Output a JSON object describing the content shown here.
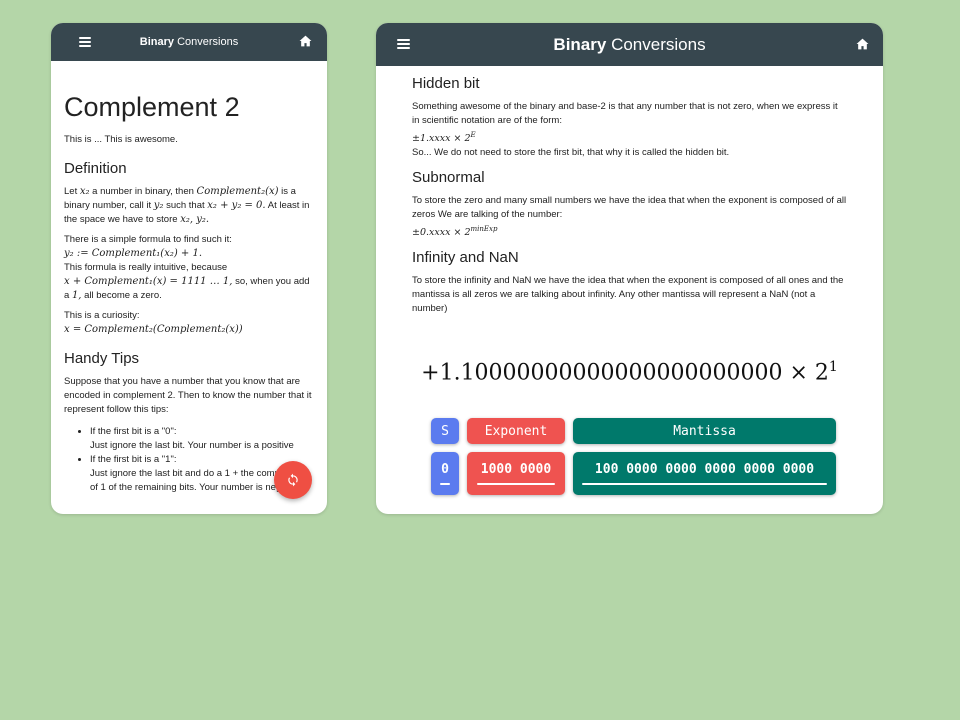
{
  "colors": {
    "background": "#b4d6a8",
    "appbar": "#37474f",
    "sign": "#5b7bef",
    "exponent": "#ef5350",
    "mantissa": "#00796b",
    "fab": "#ef4f43"
  },
  "app": {
    "title_bold": "Binary",
    "title_rest": "Conversions",
    "menu_icon": "hamburger-icon",
    "home_icon": "home-icon"
  },
  "phone": {
    "heading_light": "Complement",
    "heading_bold": "2",
    "intro": "This is ... This is awesome.",
    "definition_title": "Definition",
    "definition": {
      "p1_a": "Let",
      "p1_x2": "x₂",
      "p1_b": "a number in binary, then",
      "p1_compl": "Complement₂(x)",
      "p1_c": "is a binary number, call it",
      "p1_y2": "y₂",
      "p1_d": "such that",
      "p1_eq": "x₂ + y₂ = 0.",
      "p1_e": "At least in the space we have to store",
      "p1_xy": "x₂, y₂."
    },
    "formula_intro": "There is a simple formula to find such it:",
    "formula": "y₂ := Complement₁(x₂) + 1.",
    "intuitive": "This formula is really intuitive, because",
    "intuitive_math": "x + Complement₁(x) = 1111 … 1,",
    "intuitive_rest": "so, when you add a",
    "intuitive_one": "1,",
    "intuitive_end": "all become a zero.",
    "curiosity": "This is a curiosity:",
    "curiosity_math": "x = Complement₂(Complement₂(x))",
    "tips_title": "Handy Tips",
    "tips_intro": "Suppose that you have a number that you know that are encoded in complement 2. Then to know the number that it represent follow this tips:",
    "tips": [
      {
        "line1": "If the first bit is a \"0\":",
        "line2": "Just ignore the last bit. Your number is a positive"
      },
      {
        "line1": "If the first bit is a \"1\":",
        "line2": "Just ignore the last bit and do a 1 + the complement of 1 of the remaining bits. Your number is negative"
      }
    ],
    "fab_icon": "sync-icon"
  },
  "tablet": {
    "hidden_title": "Hidden bit",
    "hidden_text": "Something awesome of the binary and base-2 is that any number that is not zero, when we express it in scientific notation are of the form:",
    "hidden_math": "±1.xxxx × 2",
    "hidden_exp": "E",
    "hidden_after": "So... We do not need to store the first bit, that why it is called the hidden bit.",
    "subnormal_title": "Subnormal",
    "subnormal_text": "To store the zero and many small numbers we have the idea that when the exponent is composed of all zeros We are talking of the number:",
    "subnormal_math": "±0.xxxx × 2",
    "subnormal_exp": "minExp",
    "inf_title": "Infinity and NaN",
    "inf_text": "To store the infinity and NaN we have the idea that when the exponent is composed of all ones and the mantissa is all zeros we are talking about infinity. Any other mantissa will represent a NaN (not a number)",
    "big_formula": "+1.10000000000000000000000 × 2",
    "big_exp": "1",
    "sign_label": "S",
    "exponent_label": "Exponent",
    "mantissa_label": "Mantissa",
    "sign_value": "0",
    "exponent_value": "1000 0000",
    "mantissa_value": "100 0000 0000 0000 0000 0000"
  }
}
